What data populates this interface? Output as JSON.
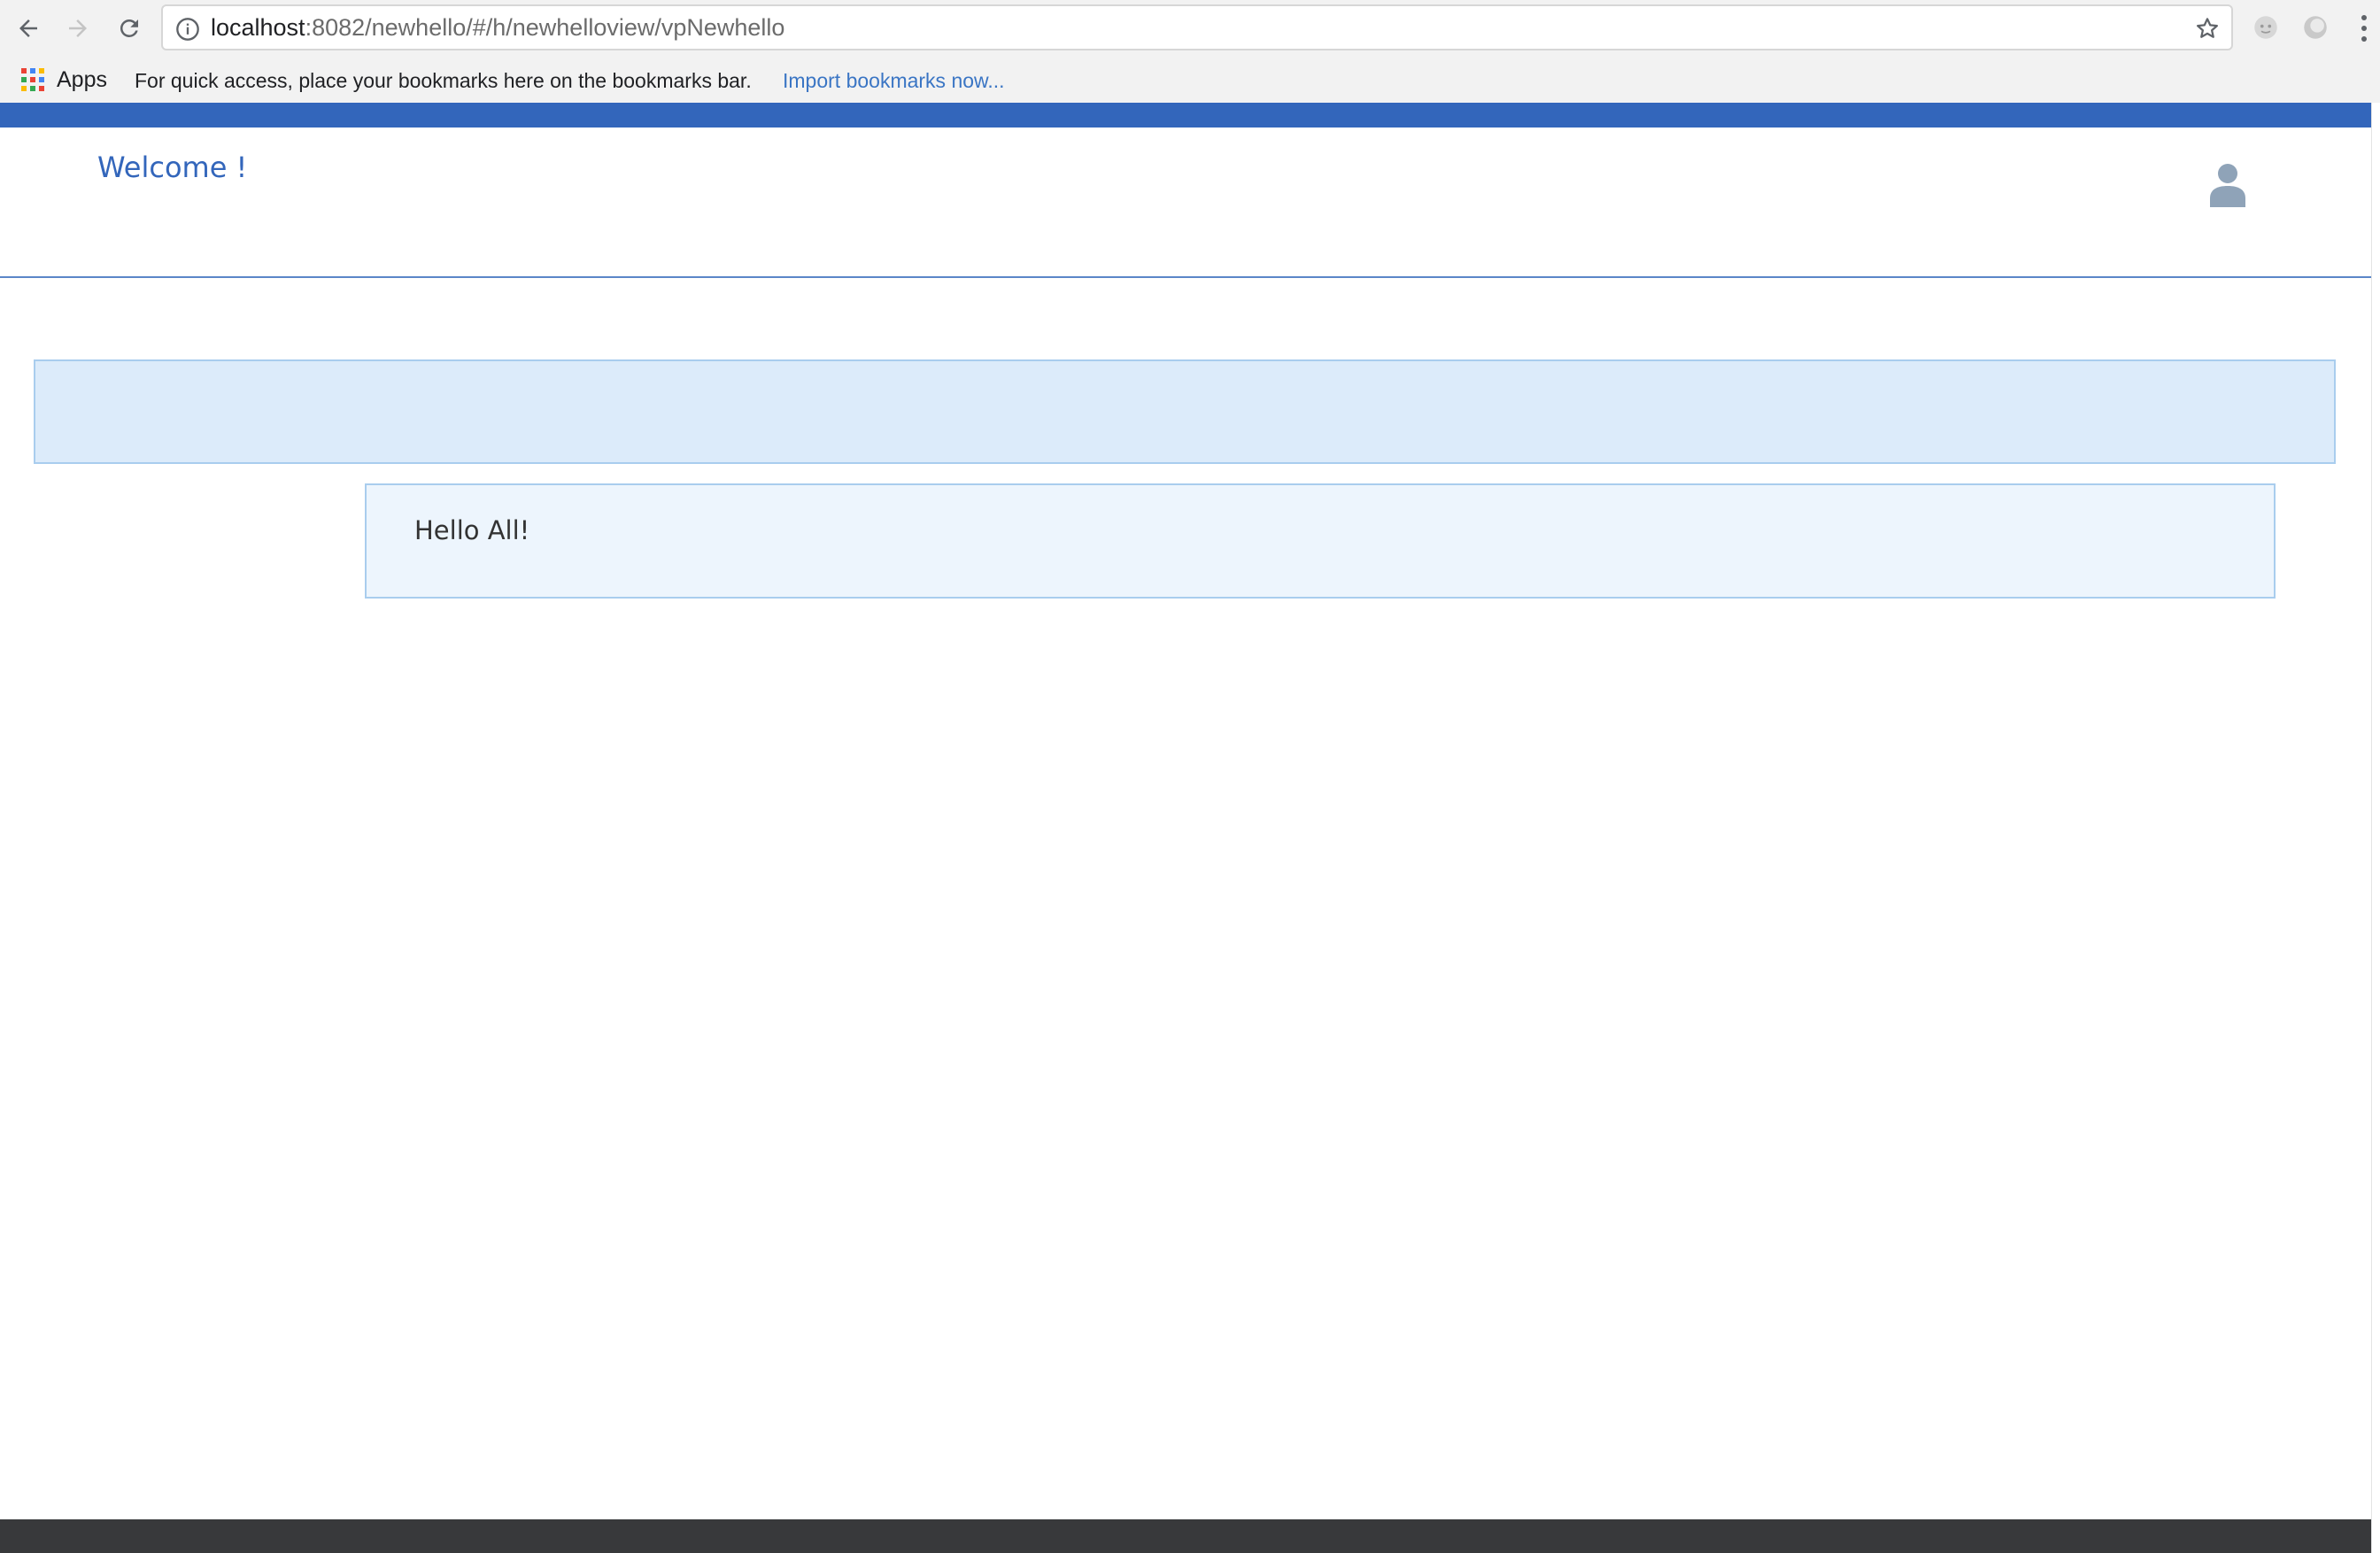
{
  "browser": {
    "url_host": "localhost",
    "url_path": ":8082/newhello/#/h/newhelloview/vpNewhello",
    "bookmarks_bar": {
      "apps_label": "Apps",
      "hint": "For quick access, place your bookmarks here on the bookmarks bar.",
      "import_link": "Import bookmarks now..."
    }
  },
  "app": {
    "welcome_text": "Welcome !",
    "panel_message": "Hello All!"
  },
  "colors": {
    "brand_blue": "#3366bb",
    "banner_bg": "#dcebfa",
    "panel_bg": "#edf5fd",
    "footer_bg": "#38393b"
  },
  "icons": [
    "back-arrow-icon",
    "forward-arrow-icon",
    "reload-icon",
    "info-icon",
    "star-icon",
    "extension-icon",
    "profile-circle-icon",
    "menu-dots-icon",
    "apps-grid-icon",
    "user-icon"
  ]
}
